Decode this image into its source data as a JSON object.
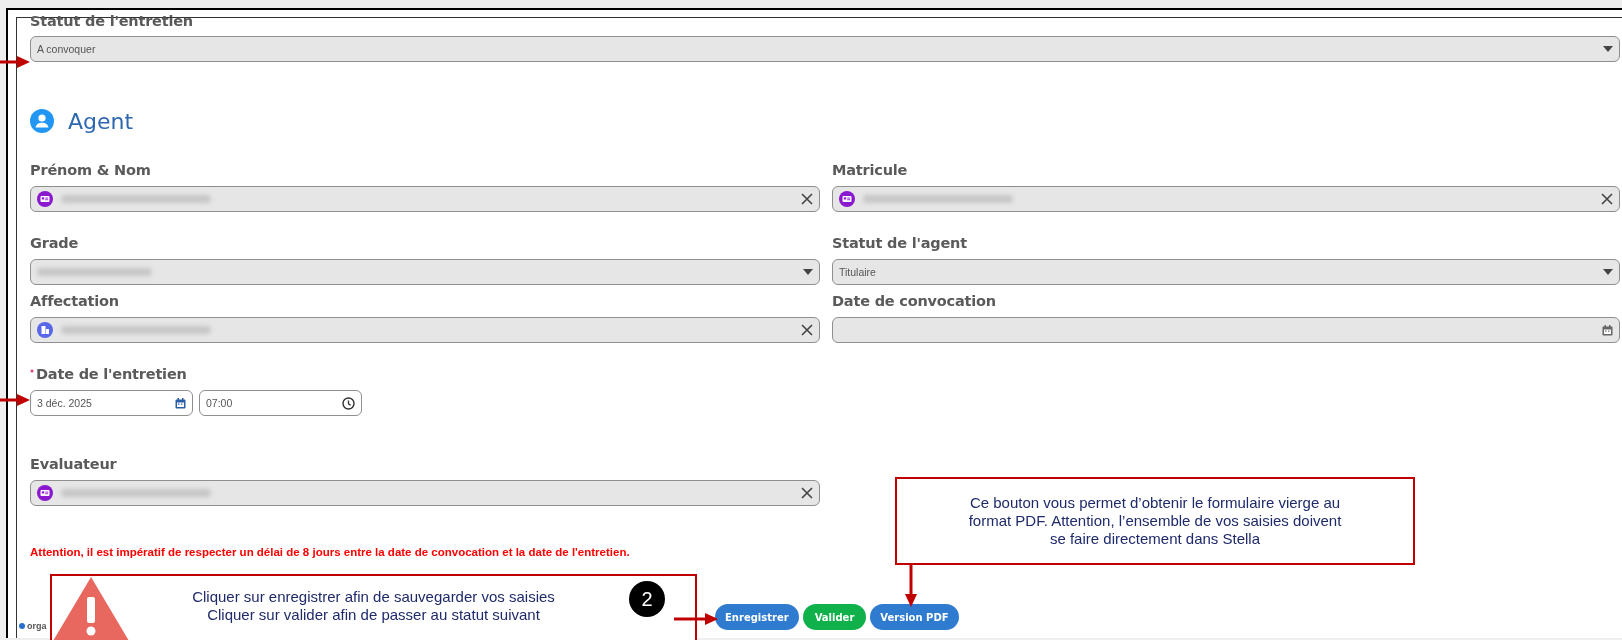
{
  "form": {
    "status_field": {
      "label": "Statut de l'entretien",
      "kind": "select",
      "value": "A convoquer"
    },
    "section": {
      "title": "Agent"
    },
    "rows": [
      [
        {
          "label": "Prénom & Nom",
          "kind": "person_lookup",
          "redacted": true
        },
        {
          "label": "Matricule",
          "kind": "person_lookup",
          "redacted": true
        }
      ],
      [
        {
          "label": "Grade",
          "kind": "select",
          "redacted": true
        },
        {
          "label": "Statut de l'agent",
          "kind": "select",
          "value": "Titulaire"
        }
      ],
      [
        {
          "label": "Affectation",
          "kind": "unit_lookup",
          "redacted": true
        },
        {
          "label": "Date de convocation",
          "kind": "date"
        }
      ],
      [
        {
          "label": "Date de l'entretien",
          "kind": "datetime",
          "required": true,
          "date": "3 déc. 2025",
          "time": "07:00"
        }
      ],
      [
        {
          "label": "Evaluateur",
          "kind": "person_lookup",
          "redacted": true
        }
      ]
    ],
    "warning": "Attention, il est impératif de respecter un délai de 8 jours entre la date de convocation et la date de l'entretien.",
    "buttons": [
      {
        "label": "Enregistrer",
        "color": "#2f7bd0"
      },
      {
        "label": "Valider",
        "color": "#10b14b"
      },
      {
        "label": "Version PDF",
        "color": "#2f7bd0"
      }
    ],
    "footer_text": "orga"
  },
  "annotations": [
    {
      "kind": "save_hint",
      "lines": [
        "Cliquer sur enregistrer afin de sauvegarder vos saisies",
        "Cliquer sur valider afin de passer au statut suivant"
      ],
      "step": "2"
    },
    {
      "kind": "pdf_hint",
      "lines": [
        "Ce bouton vous permet d’obtenir le formulaire vierge au",
        "format PDF. Attention, l’ensemble de vos saisies doivent",
        "se faire directement dans Stella"
      ]
    }
  ]
}
